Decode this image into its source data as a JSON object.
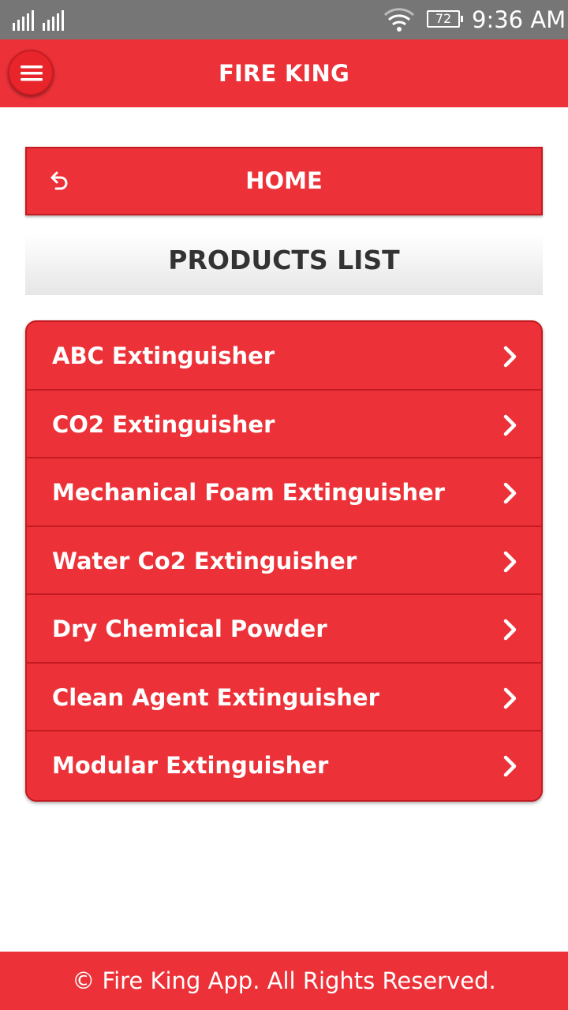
{
  "status_bar": {
    "time": "9:36 AM",
    "battery_level": "72",
    "icons": [
      "signal-icon",
      "wifi-icon",
      "battery-icon"
    ]
  },
  "app_bar": {
    "title": "FIRE KING",
    "menu_icon": "hamburger-menu-icon"
  },
  "home_button": {
    "label": "HOME",
    "icon": "back-arrow-icon"
  },
  "products": {
    "title": "PRODUCTS LIST",
    "items": [
      {
        "label": "ABC Extinguisher"
      },
      {
        "label": "CO2 Extinguisher"
      },
      {
        "label": "Mechanical Foam Extinguisher"
      },
      {
        "label": "Water Co2 Extinguisher"
      },
      {
        "label": "Dry Chemical Powder"
      },
      {
        "label": "Clean Agent Extinguisher"
      },
      {
        "label": "Modular Extinguisher"
      }
    ],
    "item_icon": "chevron-right-icon"
  },
  "footer": {
    "text": "© Fire King App. All Rights Reserved."
  },
  "colors": {
    "accent": "#ec3238",
    "status_bar": "#767676"
  }
}
